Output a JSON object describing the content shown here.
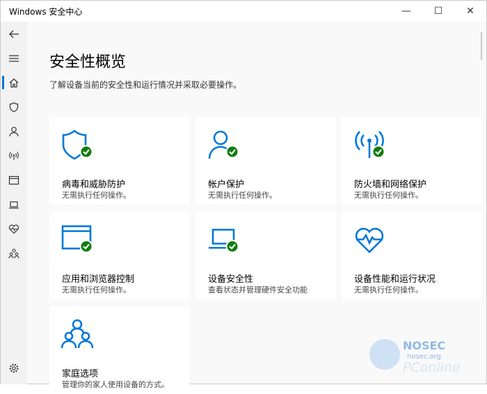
{
  "window": {
    "title": "Windows 安全中心",
    "minimize": "—",
    "maximize": "☐",
    "close": "✕"
  },
  "sidebar": {
    "items": [
      {
        "name": "back-icon"
      },
      {
        "name": "menu-icon"
      },
      {
        "name": "home-icon",
        "active": true
      },
      {
        "name": "shield-icon"
      },
      {
        "name": "account-icon"
      },
      {
        "name": "wireless-icon"
      },
      {
        "name": "browser-window-icon"
      },
      {
        "name": "laptop-icon"
      },
      {
        "name": "health-heart-icon"
      },
      {
        "name": "family-icon"
      },
      {
        "name": "settings-gear-icon"
      }
    ]
  },
  "main": {
    "title": "安全性概览",
    "subtitle": "了解设备当前的安全性和运行情况并采取必要操作。",
    "cards": [
      {
        "title": "病毒和威胁防护",
        "status": "无需执行任何操作。",
        "icon": "virus-shield-icon",
        "ok": true
      },
      {
        "title": "帐户保护",
        "status": "无需执行任何操作。",
        "icon": "account-person-icon",
        "ok": true
      },
      {
        "title": "防火墙和网络保护",
        "status": "无需执行任何操作。",
        "icon": "firewall-antenna-icon",
        "ok": true
      },
      {
        "title": "应用和浏览器控制",
        "status": "无需执行任何操作。",
        "icon": "app-browser-icon",
        "ok": true
      },
      {
        "title": "设备安全性",
        "status": "查看状态并管理硬件安全功能",
        "icon": "device-laptop-icon",
        "ok": true
      },
      {
        "title": "设备性能和运行状况",
        "status": "无需执行任何操作。",
        "icon": "health-heart-icon",
        "ok": false
      },
      {
        "title": "家庭选项",
        "status": "管理你的家人使用设备的方式。",
        "icon": "family-people-icon",
        "ok": false
      }
    ]
  },
  "colors": {
    "accent": "#0078d7",
    "ok_green": "#107c10"
  },
  "watermark": {
    "name": "NOSEC",
    "site": "nosec.org",
    "brand": "PConline"
  }
}
